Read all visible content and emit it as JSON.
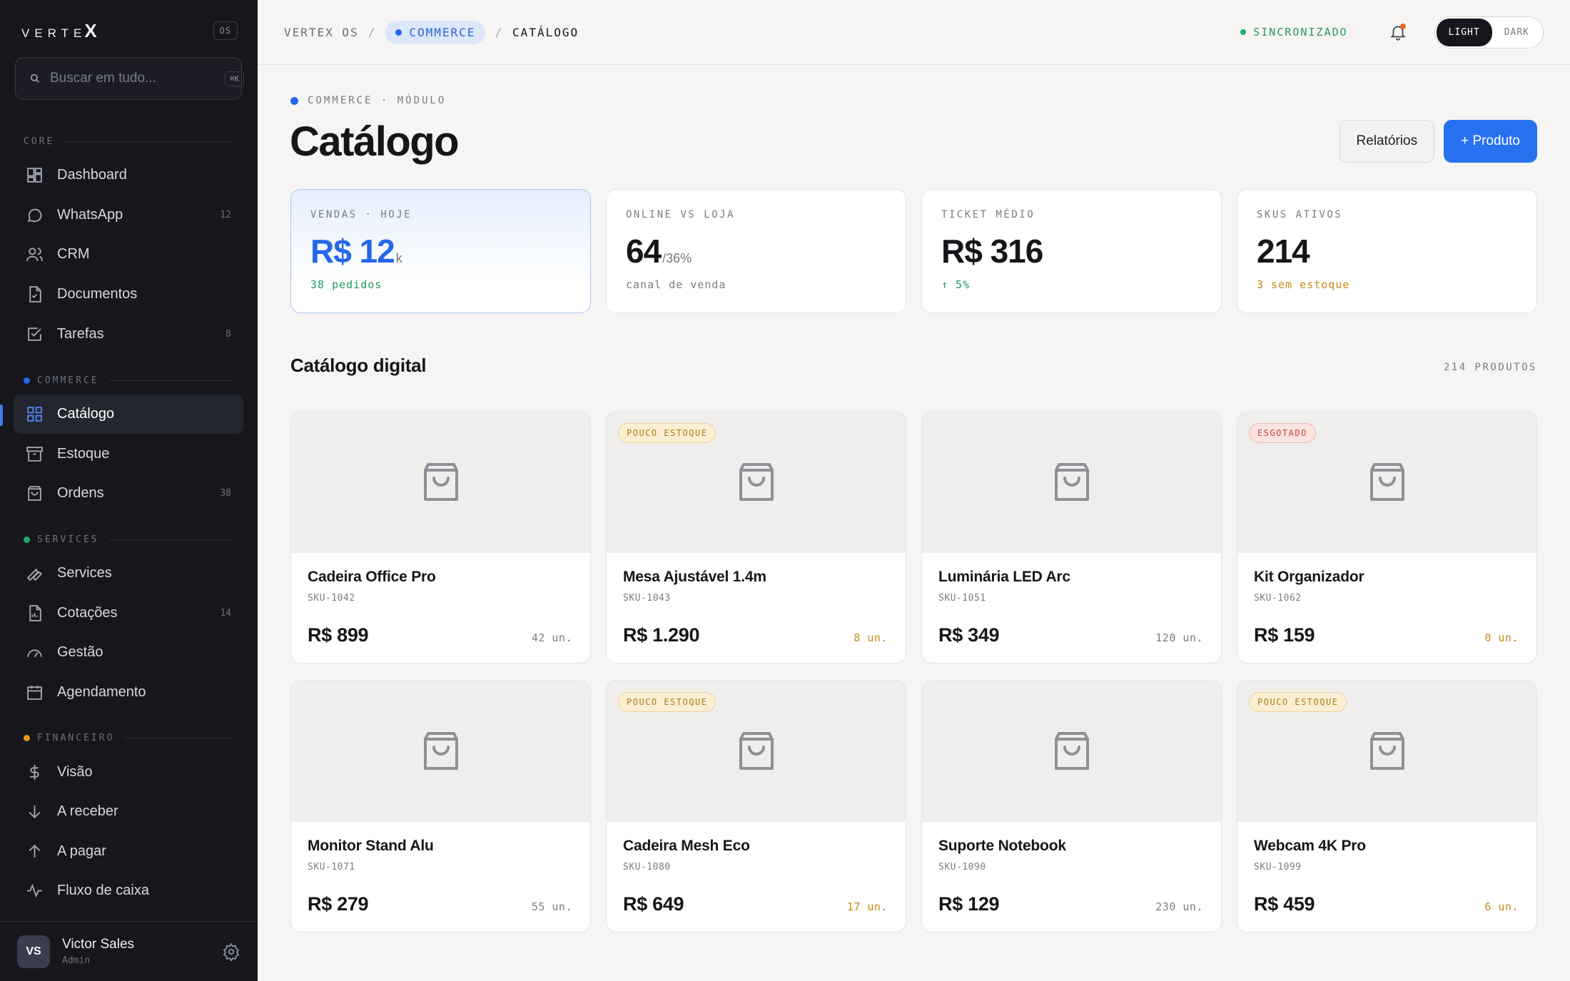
{
  "brand": {
    "logo": "VERTE",
    "logo_mark": "X",
    "os_badge": "OS"
  },
  "search": {
    "placeholder": "Buscar em tudo...",
    "shortcut": "⌘K"
  },
  "sidebar": {
    "sections": [
      {
        "label": "CORE",
        "dot_color": ""
      },
      {
        "label": "COMMERCE",
        "dot_color": "#2467e8"
      },
      {
        "label": "SERVICES",
        "dot_color": "#22a86b"
      },
      {
        "label": "FINANCEIRO",
        "dot_color": "#e39a1e"
      }
    ],
    "items": [
      {
        "label": "Dashboard",
        "icon": "dashboard-icon",
        "count": ""
      },
      {
        "label": "WhatsApp",
        "icon": "chat-icon",
        "count": "12"
      },
      {
        "label": "CRM",
        "icon": "users-icon",
        "count": ""
      },
      {
        "label": "Documentos",
        "icon": "document-icon",
        "count": ""
      },
      {
        "label": "Tarefas",
        "icon": "checkbox-icon",
        "count": "8"
      },
      {
        "label": "Catálogo",
        "icon": "grid-icon",
        "count": "",
        "active": true
      },
      {
        "label": "Estoque",
        "icon": "archive-icon",
        "count": ""
      },
      {
        "label": "Ordens",
        "icon": "bag-icon",
        "count": "38"
      },
      {
        "label": "Services",
        "icon": "wrench-icon",
        "count": ""
      },
      {
        "label": "Cotações",
        "icon": "quote-doc-icon",
        "count": "14"
      },
      {
        "label": "Gestão",
        "icon": "gauge-icon",
        "count": ""
      },
      {
        "label": "Agendamento",
        "icon": "calendar-icon",
        "count": ""
      },
      {
        "label": "Visão",
        "icon": "dollar-icon",
        "count": ""
      },
      {
        "label": "A receber",
        "icon": "arrow-down-icon",
        "count": ""
      },
      {
        "label": "A pagar",
        "icon": "arrow-up-icon",
        "count": ""
      },
      {
        "label": "Fluxo de caixa",
        "icon": "pulse-icon",
        "count": ""
      }
    ]
  },
  "user": {
    "initials": "VS",
    "name": "Victor Sales",
    "role": "Admin"
  },
  "topbar": {
    "crumbs": [
      "VERTEX OS",
      "COMMERCE",
      "CATÁLOGO"
    ],
    "sync": "SINCRONIZADO",
    "theme_options": [
      "LIGHT",
      "DARK"
    ],
    "theme_selected": "LIGHT"
  },
  "page": {
    "eyebrow": "COMMERCE · MÓDULO",
    "title": "Catálogo",
    "actions": {
      "secondary": "Relatórios",
      "primary": "+ Produto"
    }
  },
  "stats": [
    {
      "label": "VENDAS · HOJE",
      "value": "R$ 12",
      "suffix": "k",
      "sub": "38 pedidos",
      "sub_tone": "green"
    },
    {
      "label": "ONLINE VS LOJA",
      "value": "64",
      "suffix": "/36%",
      "sub": "canal de venda",
      "sub_tone": "muted"
    },
    {
      "label": "TICKET MÉDIO",
      "value": "R$ 316",
      "suffix": "",
      "sub": "↑ 5%",
      "sub_tone": "green"
    },
    {
      "label": "SKUS ATIVOS",
      "value": "214",
      "suffix": "",
      "sub": "3 sem estoque",
      "sub_tone": "amber"
    }
  ],
  "catalog": {
    "title": "Catálogo digital",
    "count": "214 PRODUTOS",
    "products": [
      {
        "name": "Cadeira Office Pro",
        "sku": "SKU-1042",
        "price": "R$ 899",
        "stock": "42 un.",
        "badge": "",
        "stock_warn": false
      },
      {
        "name": "Mesa Ajustável 1.4m",
        "sku": "SKU-1043",
        "price": "R$ 1.290",
        "stock": "8 un.",
        "badge": "POUCO ESTOQUE",
        "stock_warn": true
      },
      {
        "name": "Luminária LED Arc",
        "sku": "SKU-1051",
        "price": "R$ 349",
        "stock": "120 un.",
        "badge": "",
        "stock_warn": false
      },
      {
        "name": "Kit Organizador",
        "sku": "SKU-1062",
        "price": "R$ 159",
        "stock": "0 un.",
        "badge": "ESGOTADO",
        "stock_warn": true
      },
      {
        "name": "Monitor Stand Alu",
        "sku": "SKU-1071",
        "price": "R$ 279",
        "stock": "55 un.",
        "badge": "",
        "stock_warn": false
      },
      {
        "name": "Cadeira Mesh Eco",
        "sku": "SKU-1080",
        "price": "R$ 649",
        "stock": "17 un.",
        "badge": "POUCO ESTOQUE",
        "stock_warn": true
      },
      {
        "name": "Suporte Notebook",
        "sku": "SKU-1090",
        "price": "R$ 129",
        "stock": "230 un.",
        "badge": "",
        "stock_warn": false
      },
      {
        "name": "Webcam 4K Pro",
        "sku": "SKU-1099",
        "price": "R$ 459",
        "stock": "6 un.",
        "badge": "POUCO ESTOQUE",
        "stock_warn": true
      }
    ]
  }
}
